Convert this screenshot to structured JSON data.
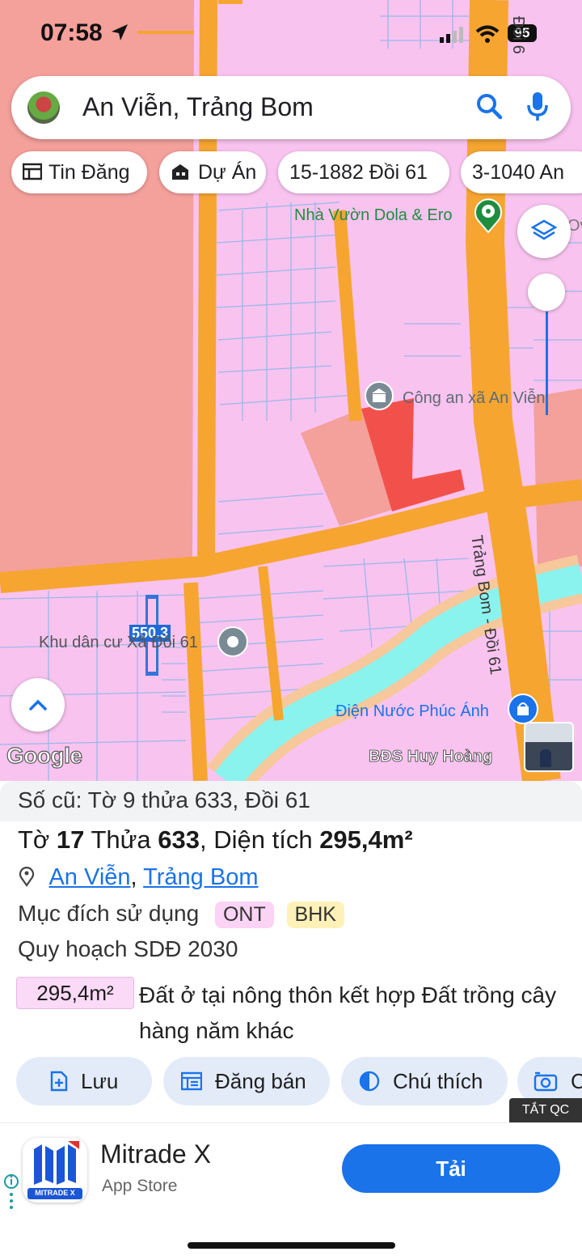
{
  "status_bar": {
    "time": "07:58",
    "battery": "95"
  },
  "search": {
    "query": "An Viễn, Trảng Bom"
  },
  "chips": [
    {
      "label": "Tin Đăng",
      "icon": "listing-icon"
    },
    {
      "label": "Dự Án",
      "icon": "building-icon"
    },
    {
      "label": "15-1882 Đồi 61"
    },
    {
      "label": "3-1040 An"
    }
  ],
  "map": {
    "labels": {
      "dola": "Nhà Vườn Dola & Ero",
      "ov": "Ov",
      "police": "Công an xã An Viễn",
      "road_main": "Trảng Bom - Đồi 61",
      "road_top": "Đồi 6",
      "khu_dan_cu": "Khu dân cư Xã Đồi 61",
      "plot_num": "550.3",
      "dien_nuoc": "Điện Nước Phúc Ánh",
      "bds": "BĐS Huy Hoàng",
      "google": "Google"
    },
    "colors": {
      "residential": "#f9c3f0",
      "agri": "#f4a09b",
      "road": "#f6a531",
      "selected_parcel": "#f2514b",
      "water": "#8bf3ee"
    }
  },
  "parcel": {
    "old_number": "Số cũ: Tờ 9 thửa 633, Đồi 61",
    "sheet_word": "Tờ",
    "sheet_no": "17",
    "plot_word": "Thửa",
    "plot_no": "633",
    "area_word": "Diện tích",
    "area": "295,4m²",
    "location": {
      "ward": "An Viễn",
      "district": "Trảng Bom",
      "sep": ","
    },
    "usage_label": "Mục đích sử dụng",
    "usage_tags": [
      {
        "code": "ONT",
        "color": "#fad3f5"
      },
      {
        "code": "BHK",
        "color": "#fff1b8"
      }
    ],
    "planning_label": "Quy hoạch SDĐ 2030",
    "planning_area": "295,4m²",
    "planning_desc": "Đất ở tại nông thôn kết hợp Đất trồng cây hàng năm khác"
  },
  "actions": [
    {
      "label": "Lưu",
      "icon": "save-icon"
    },
    {
      "label": "Đăng bán",
      "icon": "post-icon"
    },
    {
      "label": "Chú thích",
      "icon": "legend-icon"
    },
    {
      "label": "C",
      "icon": "camera-icon"
    }
  ],
  "ad": {
    "close_label": "TẮT QC",
    "app_name": "Mitrade X",
    "store": "App Store",
    "logo_text": "MITRADE X",
    "cta": "Tải"
  }
}
